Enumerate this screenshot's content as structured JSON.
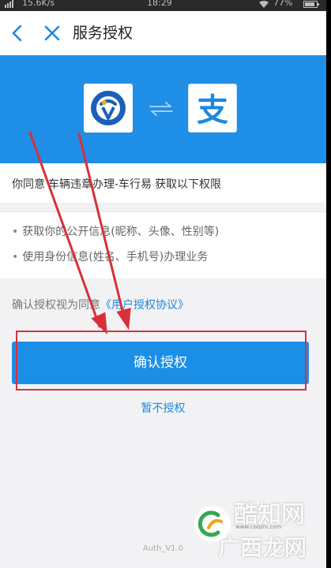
{
  "status_bar": {
    "network_speed": "15.6K/s",
    "time": "18:29",
    "battery": "77%"
  },
  "nav": {
    "title": "服务授权",
    "back_icon": "chevron-left-icon",
    "close_icon": "close-icon"
  },
  "banner": {
    "color": "#1f8ee6",
    "app_logo_icon": "app-logo-icon",
    "swap_icon": "swap-arrows-icon",
    "alipay_logo": "支"
  },
  "consent": {
    "prefix": "你同意",
    "app_name": "车辆违章办理-车行易",
    "suffix": "获取以下权限"
  },
  "permissions": [
    "获取你的公开信息(昵称、头像、性别等)",
    "使用身份信息(姓名、手机号)办理业务"
  ],
  "agreement": {
    "prefix": "确认授权视为同意",
    "link": "《用户授权协议》"
  },
  "actions": {
    "confirm": "确认授权",
    "deny": "暂不授权"
  },
  "version": "Auth_V1.0",
  "watermark": {
    "brand_top": "酷知网",
    "brand_bottom": "广西龙网",
    "url": "www.coozhi.com"
  },
  "colors": {
    "accent": "#1b8fe6",
    "link": "#1d88e0",
    "annotation": "#d7303a"
  }
}
